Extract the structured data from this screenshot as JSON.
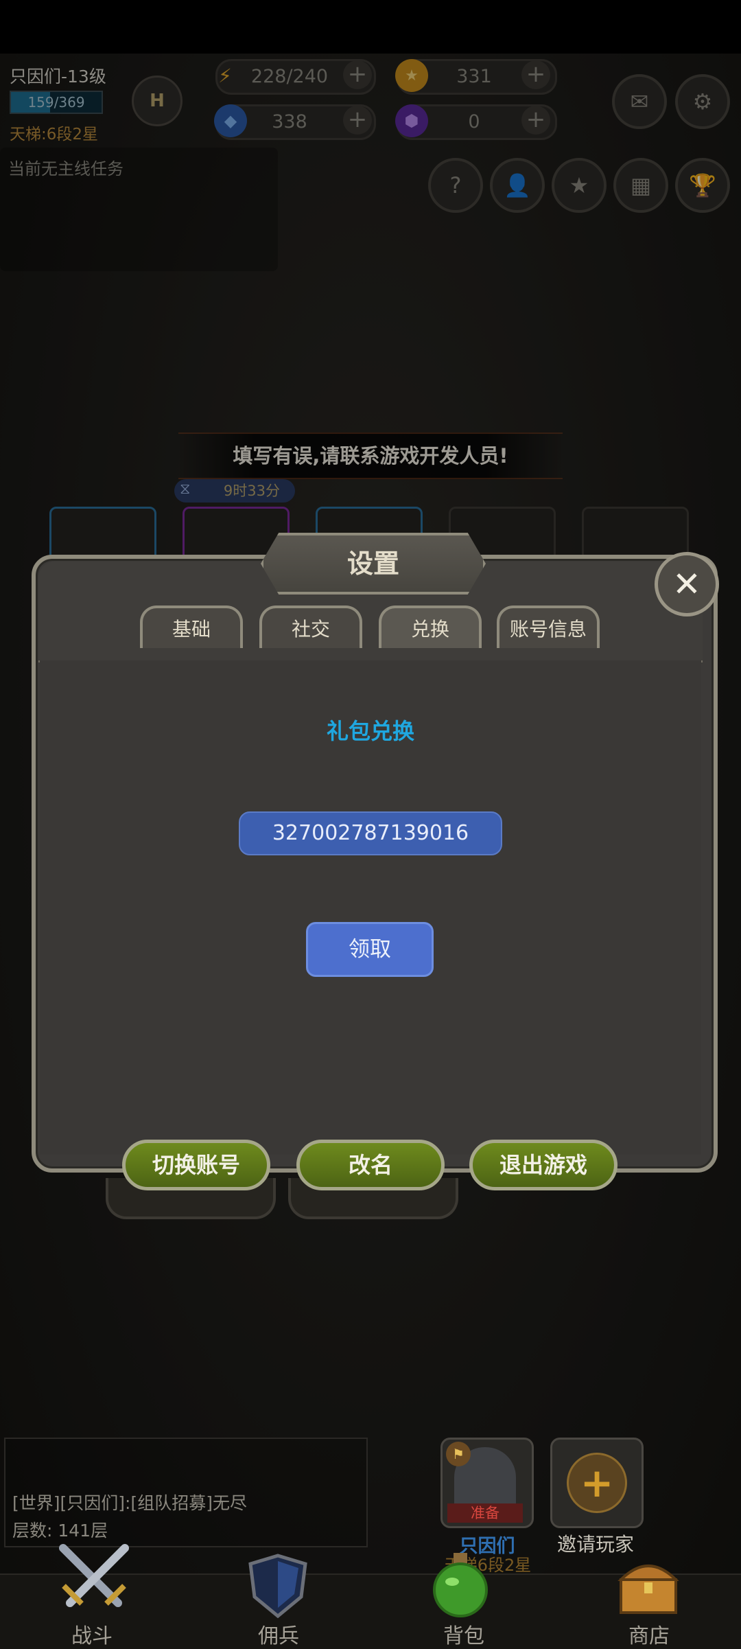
{
  "hud": {
    "player_name": "只因们-13级",
    "xp_text": "159/369",
    "xp_fraction": 0.43,
    "ladder": "天梯:6段2星",
    "rank_emblem": "H",
    "energy": "228/240",
    "gold": "331",
    "gems": "338",
    "purple_gems": "0",
    "plus": "+"
  },
  "quest": {
    "text": "当前无主线任务"
  },
  "error_banner": {
    "text": "填写有误,请联系游戏开发人员!"
  },
  "timer": {
    "text": "9时33分"
  },
  "dialog": {
    "title": "设置",
    "close": "✕",
    "tabs": [
      {
        "label": "基础"
      },
      {
        "label": "社交"
      },
      {
        "label": "兑换"
      },
      {
        "label": "账号信息"
      }
    ],
    "active_tab": "兑换",
    "section_title": "礼包兑换",
    "code_value": "327002787139016",
    "claim_label": "领取",
    "footer": {
      "switch_account": "切换账号",
      "rename": "改名",
      "quit_game": "退出游戏"
    }
  },
  "chat": {
    "line1": "[世界][只因们]:[组队招募]无尽",
    "line2": "层数: 141层"
  },
  "party": {
    "ready_tag": "准备",
    "member_name": "只因们",
    "member_rank": "天梯6段2星",
    "invite_label": "邀请玩家"
  },
  "nav": {
    "battle": "战斗",
    "mercenary": "佣兵",
    "backpack": "背包",
    "shop": "商店"
  },
  "colors": {
    "accent_blue": "#1fa7e0",
    "button_blue": "#4d6fce",
    "button_green": "#5f7a19"
  }
}
